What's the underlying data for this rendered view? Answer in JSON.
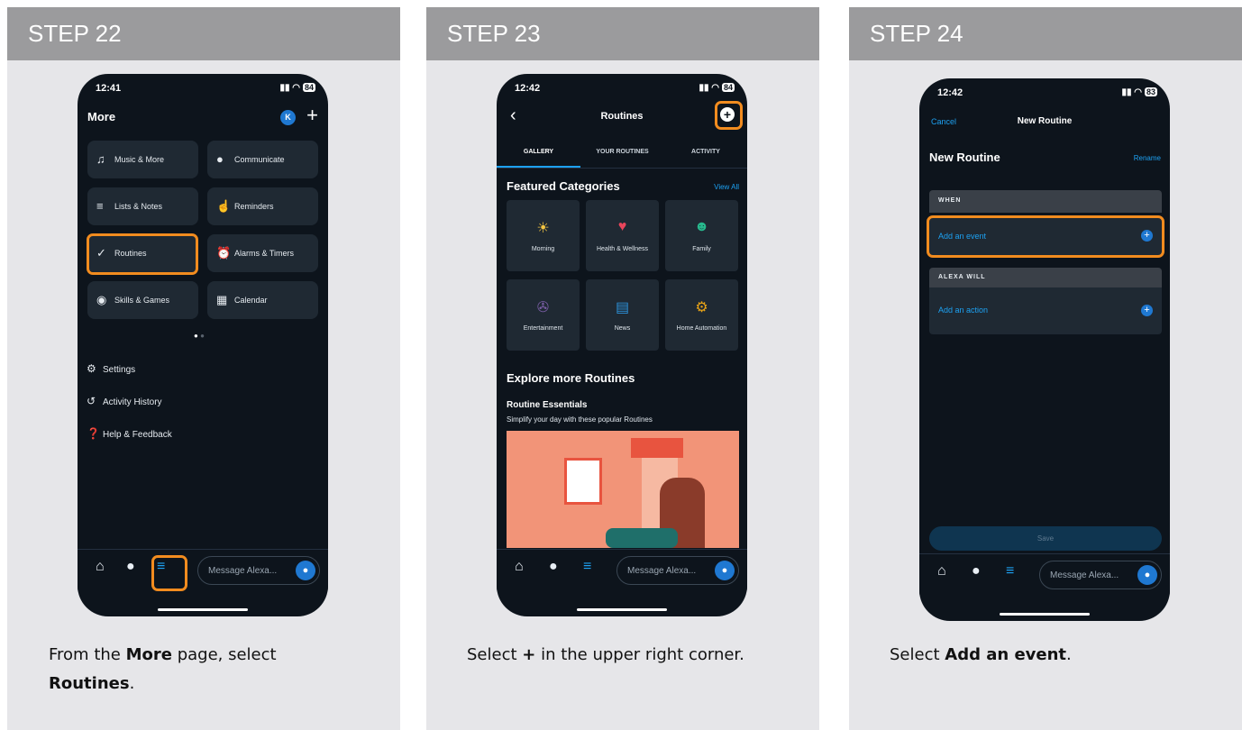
{
  "steps": [
    {
      "header": "STEP 22",
      "caption": {
        "pre": "From the ",
        "b1": "More",
        "mid": " page, select ",
        "b2": "Routines",
        "post": "."
      },
      "phone": {
        "time": "12:41",
        "battery": "84",
        "title": "More",
        "avatar_letter": "K",
        "plus": "+",
        "tiles": [
          "Music & More",
          "Communicate",
          "Lists & Notes",
          "Reminders",
          "Routines",
          "Alarms & Timers",
          "Skills & Games",
          "Calendar"
        ],
        "menu": [
          "Settings",
          "Activity History",
          "Help & Feedback"
        ],
        "message_placeholder": "Message Alexa..."
      }
    },
    {
      "header": "STEP 23",
      "caption": {
        "pre": "Select ",
        "b1": "+",
        "post": " in the upper right corner."
      },
      "phone": {
        "time": "12:42",
        "battery": "84",
        "title": "Routines",
        "tabs": [
          "GALLERY",
          "YOUR ROUTINES",
          "ACTIVITY"
        ],
        "featured": "Featured Categories",
        "view_all": "View All",
        "categories": [
          "Morning",
          "Health & Wellness",
          "Family",
          "Entertainment",
          "News",
          "Home Automation"
        ],
        "explore": "Explore more Routines",
        "essentials": "Routine Essentials",
        "essentials_sub": "Simplify your day with these popular Routines",
        "message_placeholder": "Message Alexa..."
      }
    },
    {
      "header": "STEP 24",
      "caption": {
        "pre": "Select ",
        "b1": "Add an event",
        "post": "."
      },
      "phone": {
        "time": "12:42",
        "battery": "83",
        "cancel": "Cancel",
        "title": "New Routine",
        "routine_name": "New Routine",
        "rename": "Rename",
        "when": "WHEN",
        "add_event": "Add an event",
        "alexa_will": "ALEXA WILL",
        "add_action": "Add an action",
        "save": "Save",
        "message_placeholder": "Message Alexa..."
      }
    }
  ],
  "colors": {
    "highlight": "#f28c1f",
    "accent": "#1da1f2",
    "phone_bg": "#0d141c"
  }
}
